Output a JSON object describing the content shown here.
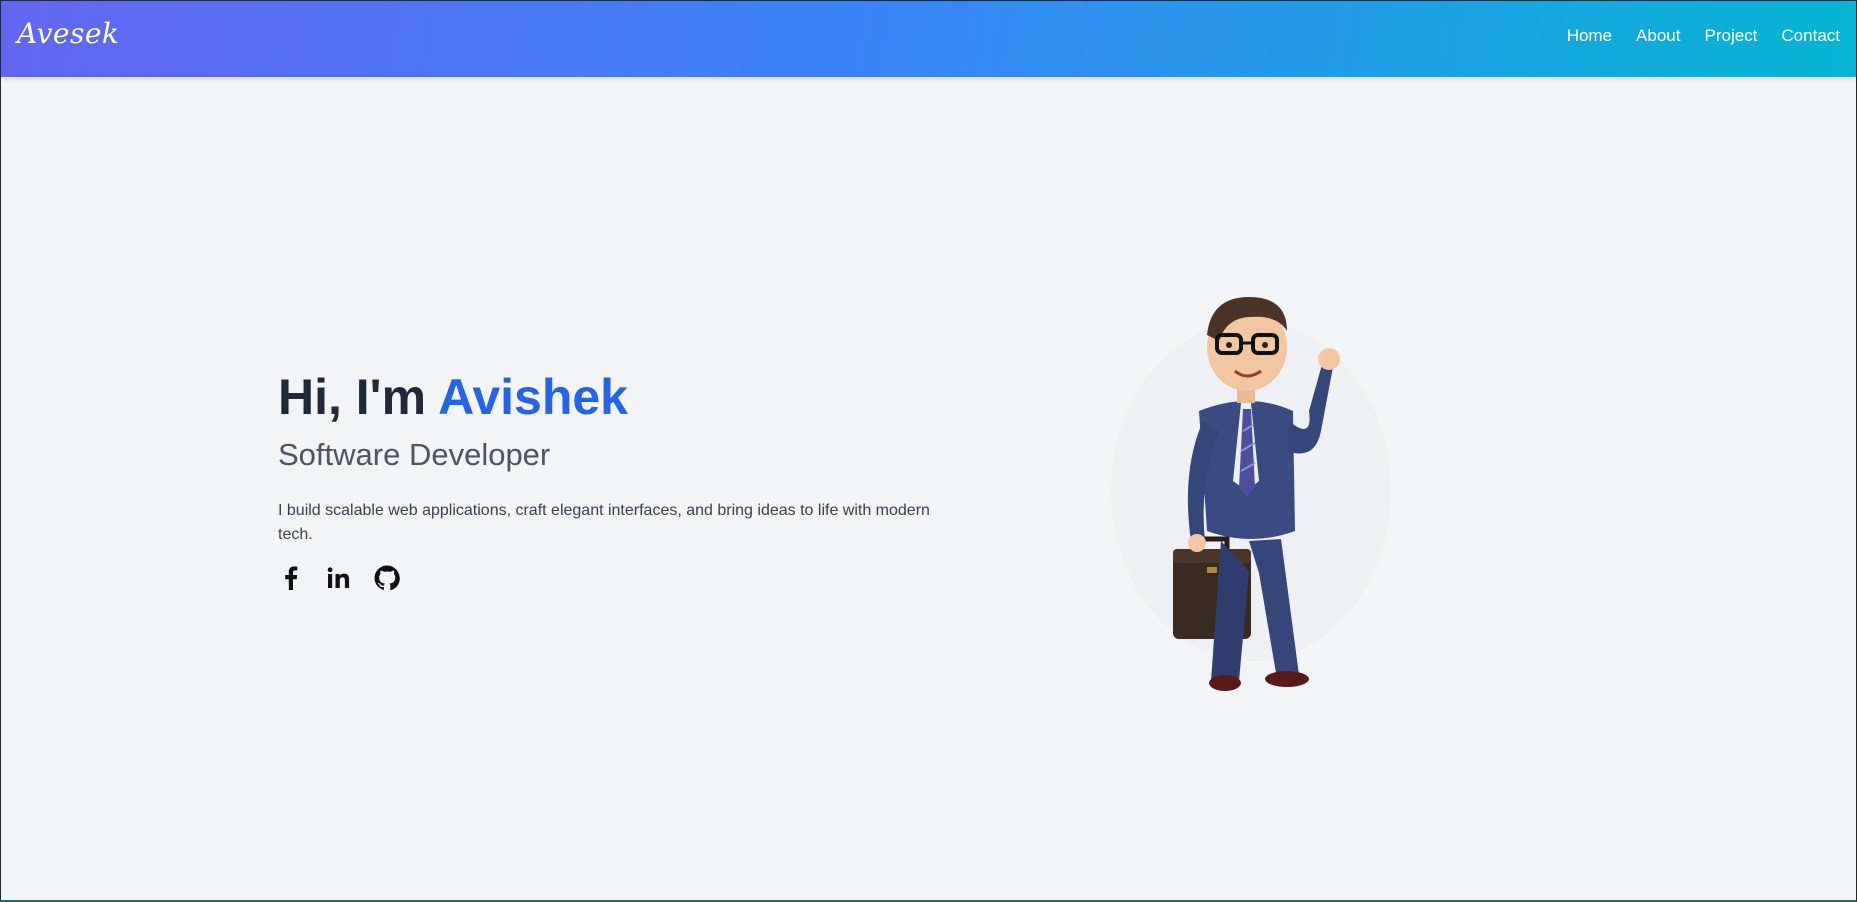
{
  "nav": {
    "brand": "Avesek",
    "links": [
      "Home",
      "About",
      "Project",
      "Contact"
    ]
  },
  "hero": {
    "greeting": "Hi, I'm ",
    "name": "Avishek",
    "role": "Software Developer",
    "description": "I build scalable web applications, craft elegant interfaces, and bring ideas to life with modern tech.",
    "socials": [
      "facebook-icon",
      "linkedin-icon",
      "github-icon"
    ],
    "illustration": "cartoon-businessman-with-briefcase"
  },
  "colors": {
    "nav_gradient_start": "#6366f1",
    "nav_gradient_end": "#06b6d4",
    "accent": "#2563eb",
    "background": "#f3f4f6",
    "heading": "#1f2937"
  }
}
